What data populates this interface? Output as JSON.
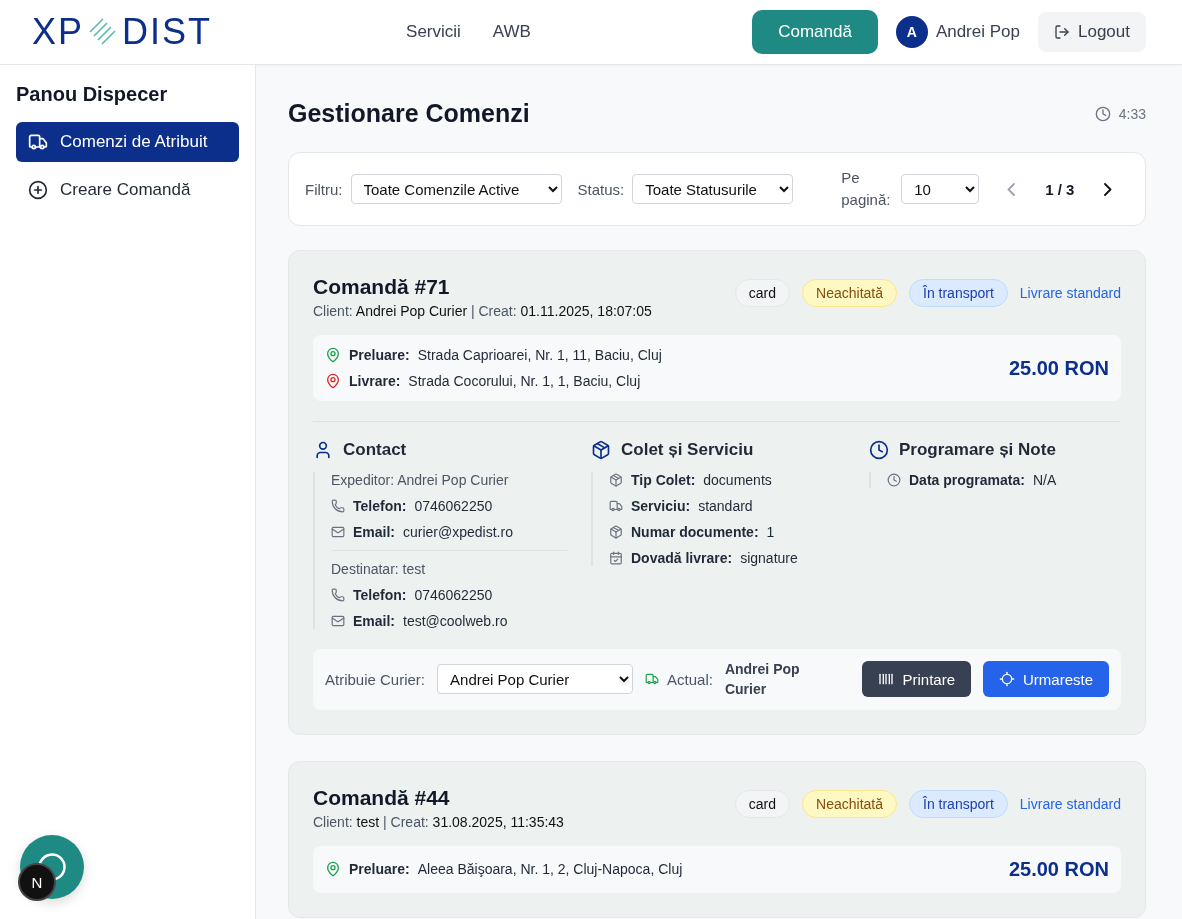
{
  "header": {
    "logo": {
      "left": "XP",
      "right": "DIST"
    },
    "nav": [
      "Servicii",
      "AWB"
    ],
    "order_button": "Comandă",
    "user": {
      "initial": "A",
      "name": "Andrei Pop"
    },
    "logout": "Logout"
  },
  "sidebar": {
    "title": "Panou Dispecer",
    "items": [
      {
        "label": "Comenzi de Atribuit",
        "kind": "truck",
        "selected": true
      },
      {
        "label": "Creare Comandă",
        "kind": "plus",
        "selected": false
      }
    ]
  },
  "main": {
    "title": "Gestionare Comenzi",
    "clock": "4:33"
  },
  "filters": {
    "items": [
      {
        "label": "Filtru:",
        "value": "Toate Comenzile Active"
      },
      {
        "label": "Status:",
        "value": "Toate Statusurile"
      }
    ],
    "per_page": {
      "label": "Pe pagină:",
      "value": "10"
    },
    "page": "1 / 3"
  },
  "orders": [
    {
      "title": "Comandă #71",
      "meta": "Client: **Andrei Pop Curier** | Creat: **01.11.2025, 18:07:05**",
      "badges": [
        {
          "text": "card",
          "kind": "method"
        },
        {
          "text": "Neachitată",
          "kind": "unpaid"
        },
        {
          "text": "În transport",
          "kind": "status"
        },
        {
          "text": "Livrare standard",
          "kind": "link"
        }
      ],
      "route": [
        {
          "kind": "pickup",
          "label": "Preluare:",
          "value": "Strada Caprioarei, Nr. 1, 11, Baciu, Cluj"
        },
        {
          "kind": "delivery",
          "label": "Livrare:",
          "value": "Strada Cocorului, Nr. 1, 1, Baciu, Cluj"
        }
      ],
      "price": "25.00 RON",
      "contact": {
        "title": "Contact",
        "people": [
          {
            "heading": "Expeditor: Andrei Pop Curier",
            "rows": [
              {
                "kind": "phone",
                "label": "Telefon:",
                "value": "0746062250"
              },
              {
                "kind": "mail",
                "label": "Email:",
                "value": "curier@xpedist.ro"
              }
            ]
          },
          {
            "heading": "Destinatar: test",
            "rows": [
              {
                "kind": "phone",
                "label": "Telefon:",
                "value": "0746062250"
              },
              {
                "kind": "mail",
                "label": "Email:",
                "value": "test@coolweb.ro"
              }
            ]
          }
        ]
      },
      "package": {
        "title": "Colet și Serviciu",
        "rows": [
          {
            "kind": "box",
            "label": "Tip Colet:",
            "value": "documents"
          },
          {
            "kind": "truck",
            "label": "Serviciu:",
            "value": "standard"
          },
          {
            "kind": "box",
            "label": "Numar documente:",
            "value": "1"
          },
          {
            "kind": "calendar",
            "label": "Dovadă livrare:",
            "value": "signature"
          }
        ]
      },
      "schedule": {
        "title": "Programare și Note",
        "rows": [
          {
            "kind": "clock",
            "label": "Data programata:",
            "value": "N/A"
          }
        ]
      },
      "assign": {
        "label": "Atribuie Curier:",
        "courier": "Andrei Pop Curier",
        "current_label": "Actual:",
        "current": "Andrei Pop Curier",
        "print": "Printare",
        "track": "Urmareste"
      }
    },
    {
      "title": "Comandă #44",
      "meta": "Client: **test** | Creat: **31.08.2025, 11:35:43**",
      "badges": [
        {
          "text": "card",
          "kind": "method"
        },
        {
          "text": "Neachitată",
          "kind": "unpaid"
        },
        {
          "text": "În transport",
          "kind": "status"
        },
        {
          "text": "Livrare standard",
          "kind": "link"
        }
      ],
      "route": [
        {
          "kind": "pickup",
          "label": "Preluare:",
          "value": "Aleea Băişoara, Nr. 1, 2, Cluj-Napoca, Cluj"
        }
      ],
      "price": "25.00 RON"
    }
  ],
  "dev_badge": "N"
}
